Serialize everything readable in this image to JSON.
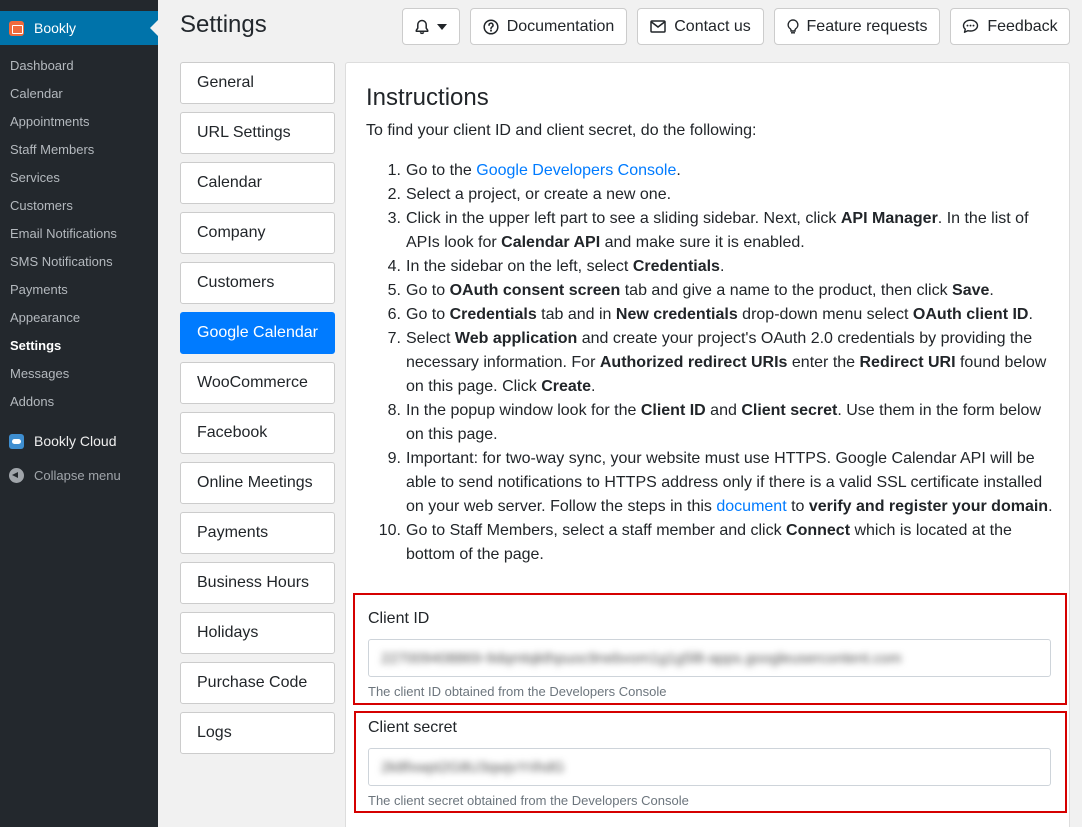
{
  "wp_menu": {
    "brand": "Bookly",
    "items": [
      "Dashboard",
      "Calendar",
      "Appointments",
      "Staff Members",
      "Services",
      "Customers",
      "Email Notifications",
      "SMS Notifications",
      "Payments",
      "Appearance",
      "Settings",
      "Messages",
      "Addons"
    ],
    "current": "Settings",
    "cloud": "Bookly Cloud",
    "collapse": "Collapse menu"
  },
  "header": {
    "title": "Settings",
    "buttons": {
      "documentation": "Documentation",
      "contact": "Contact us",
      "feature_requests": "Feature requests",
      "feedback": "Feedback"
    }
  },
  "tabs": [
    "General",
    "URL Settings",
    "Calendar",
    "Company",
    "Customers",
    "Google Calendar",
    "WooCommerce",
    "Facebook",
    "Online Meetings",
    "Payments",
    "Business Hours",
    "Holidays",
    "Purchase Code",
    "Logs"
  ],
  "active_tab": "Google Calendar",
  "instructions": {
    "title": "Instructions",
    "intro": "To find your client ID and client secret, do the following:",
    "steps": [
      [
        {
          "t": "Go to the "
        },
        {
          "t": "Google Developers Console",
          "link": true
        },
        {
          "t": "."
        }
      ],
      [
        {
          "t": "Select a project, or create a new one."
        }
      ],
      [
        {
          "t": "Click in the upper left part to see a sliding sidebar. Next, click "
        },
        {
          "t": "API Manager",
          "b": true
        },
        {
          "t": ". In the list of APIs look for "
        },
        {
          "t": "Calendar API",
          "b": true
        },
        {
          "t": " and make sure it is enabled."
        }
      ],
      [
        {
          "t": "In the sidebar on the left, select "
        },
        {
          "t": "Credentials",
          "b": true
        },
        {
          "t": "."
        }
      ],
      [
        {
          "t": "Go to "
        },
        {
          "t": "OAuth consent screen",
          "b": true
        },
        {
          "t": " tab and give a name to the product, then click "
        },
        {
          "t": "Save",
          "b": true
        },
        {
          "t": "."
        }
      ],
      [
        {
          "t": "Go to "
        },
        {
          "t": "Credentials",
          "b": true
        },
        {
          "t": " tab and in "
        },
        {
          "t": "New credentials",
          "b": true
        },
        {
          "t": " drop-down menu select "
        },
        {
          "t": "OAuth client ID",
          "b": true
        },
        {
          "t": "."
        }
      ],
      [
        {
          "t": "Select "
        },
        {
          "t": "Web application",
          "b": true
        },
        {
          "t": " and create your project's OAuth 2.0 credentials by providing the necessary information. For "
        },
        {
          "t": "Authorized redirect URIs",
          "b": true
        },
        {
          "t": " enter the "
        },
        {
          "t": "Redirect URI",
          "b": true
        },
        {
          "t": " found below on this page. Click "
        },
        {
          "t": "Create",
          "b": true
        },
        {
          "t": "."
        }
      ],
      [
        {
          "t": "In the popup window look for the "
        },
        {
          "t": "Client ID",
          "b": true
        },
        {
          "t": " and "
        },
        {
          "t": "Client secret",
          "b": true
        },
        {
          "t": ". Use them in the form below on this page."
        }
      ],
      [
        {
          "t": "Important: for two-way sync, your website must use HTTPS. Google Calendar API will be able to send notifications to HTTPS address only if there is a valid SSL certificate installed on your web server. Follow the steps in this "
        },
        {
          "t": "document",
          "link": true
        },
        {
          "t": " to "
        },
        {
          "t": "verify and register your domain",
          "b": true
        },
        {
          "t": "."
        }
      ],
      [
        {
          "t": "Go to Staff Members, select a staff member and click "
        },
        {
          "t": "Connect",
          "b": true
        },
        {
          "t": " which is located at the bottom of the page."
        }
      ]
    ]
  },
  "client_id": {
    "label": "Client ID",
    "value": "227009408869-9dqmtqkthpuoc9nebvom1g1g5l8-apps.googleusercontent.com",
    "help": "The client ID obtained from the Developers Console"
  },
  "client_secret": {
    "label": "Client secret",
    "value": "2k8fxwpt2G8U3qwjvYrihdG",
    "help": "The client secret obtained from the Developers Console"
  },
  "colors": {
    "primary": "#007bff",
    "wp_sidebar": "#23282d",
    "wp_blue": "#0073aa",
    "highlight_border": "#d50000"
  }
}
